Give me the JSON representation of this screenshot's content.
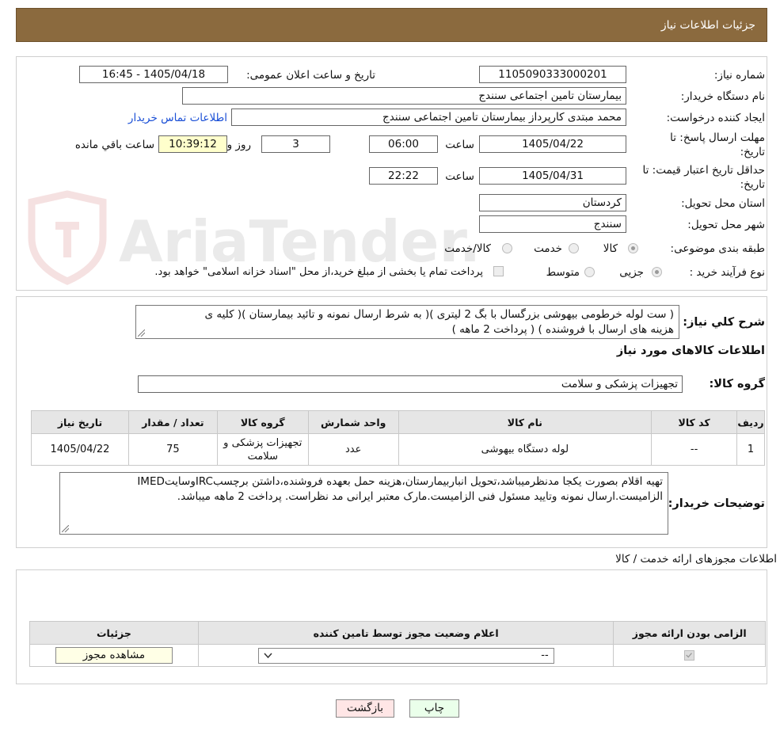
{
  "header": {
    "title": "جزئیات اطلاعات نیاز"
  },
  "form": {
    "need_number_label": "شماره نیاز:",
    "need_number": "1105090333000201",
    "announce_label": "تاریخ و ساعت اعلان عمومی:",
    "announce_value": "1405/04/18 - 16:45",
    "buyer_label": "نام دستگاه خریدار:",
    "buyer_value": "بیمارستان تامین اجتماعی سنندج",
    "creator_label": "ایجاد کننده درخواست:",
    "creator_value": "محمد مبتدی کارپرداز بیمارستان تامین اجتماعی سنندج",
    "contact_link": "اطلاعات تماس خریدار",
    "reply_label_1": "مهلت ارسال پاسخ: تا",
    "reply_label_2": "تاریخ:",
    "reply_date": "1405/04/22",
    "time_label": "ساعت",
    "reply_time": "06:00",
    "days_value": "3",
    "days_label": "روز و",
    "remaining_time": "10:39:12",
    "remaining_label": "ساعت باقي مانده",
    "validity_label_1": "حداقل تاریخ اعتبار قیمت: تا",
    "validity_label_2": "تاریخ:",
    "validity_date": "1405/04/31",
    "validity_time": "22:22",
    "province_label": "استان محل تحویل:",
    "province_value": "کردستان",
    "city_label": "شهر محل تحویل:",
    "city_value": "سنندج",
    "category_label": "طبقه بندی موضوعی:",
    "category_options": [
      "کالا",
      "خدمت",
      "کالا/خدمت"
    ],
    "process_label": "نوع فرآیند خرید :",
    "process_options": [
      "جزیی",
      "متوسط"
    ],
    "payment_note": "پرداخت تمام یا بخشی از مبلغ خرید،از محل \"اسناد خزانه اسلامی\" خواهد بود."
  },
  "description": {
    "label": "شرح کلي نیاز:",
    "line1": "( ست لوله خرطومی بیهوشی بزرگسال با بگ 2 لیتری )( به شرط ارسال نمونه و تائید بیمارستان )( کلیه ی",
    "line2": "هزینه های ارسال با فروشنده ) ( پرداخت 2 ماهه )"
  },
  "goods": {
    "section_title": "اطلاعات کالاهای مورد نیاز",
    "group_label": "گروه کالا:",
    "group_value": "تجهیزات پزشکی و سلامت",
    "columns": [
      "ردیف",
      "کد کالا",
      "نام کالا",
      "واحد شمارش",
      "گروه کالا",
      "تعداد / مقدار",
      "تاریخ نیاز"
    ],
    "rows": [
      {
        "index": "1",
        "code": "--",
        "name": "لوله دستگاه بیهوشی",
        "unit": "عدد",
        "group_1": "تجهیزات پزشکی و",
        "group_2": "سلامت",
        "qty": "75",
        "date": "1405/04/22"
      }
    ]
  },
  "buyer_notes": {
    "label": "توضیحات خریدار:",
    "line1": "تهیه اقلام بصورت یکجا مدنظرمیباشد،تحویل انباربیمارستان،هزینه حمل بعهده فروشنده،داشتن برچسبIRCوسایتIMED",
    "line2": "الزامیست.ارسال نمونه وتایید مسئول فنی الزامیست.مارک معتبر ایرانی مد نظراست. پرداخت 2 ماهه میباشد."
  },
  "licenses": {
    "section_title": "اطلاعات مجوزهای ارائه خدمت / کالا",
    "columns": [
      "الزامی بودن ارائه مجوز",
      "اعلام وضعیت مجوز توسط تامین کننده",
      "جزئیات"
    ],
    "select_value": "--",
    "view_button": "مشاهده مجوز"
  },
  "actions": {
    "print": "چاپ",
    "back": "بازگشت"
  },
  "watermark": {
    "text": "AriaTender.neT"
  },
  "colors": {
    "header_bg": "#8B6A3E",
    "link": "#1a4fd6",
    "print_bg": "#eaffea",
    "back_bg": "#ffe6e6"
  }
}
